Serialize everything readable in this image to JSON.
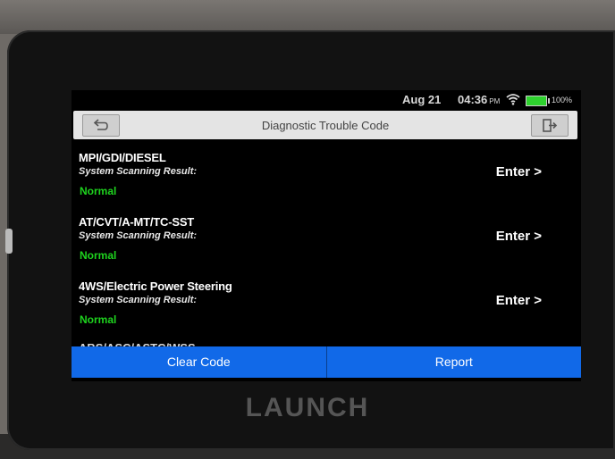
{
  "status_bar": {
    "date": "Aug 21",
    "time": "04:36",
    "ampm": "PM",
    "battery": "100%",
    "wifi_icon": "wifi-icon",
    "battery_icon": "battery-icon"
  },
  "header": {
    "title": "Diagnostic Trouble Code",
    "back_icon": "back-arrow-icon",
    "exit_icon": "exit-icon"
  },
  "systems": [
    {
      "name": "MPI/GDI/DIESEL",
      "sub": "System Scanning Result:",
      "status": "Normal",
      "enter": "Enter >"
    },
    {
      "name": "AT/CVT/A-MT/TC-SST",
      "sub": "System Scanning Result:",
      "status": "Normal",
      "enter": "Enter >"
    },
    {
      "name": "4WS/Electric Power Steering",
      "sub": "System Scanning Result:",
      "status": "Normal",
      "enter": "Enter >"
    }
  ],
  "next_item_partial": "ABS/ASC/ASTC/WSS",
  "actions": {
    "clear_code": "Clear Code",
    "report": "Report"
  },
  "device": {
    "brand": "LAUNCH"
  },
  "colors": {
    "accent_blue": "#1169e8",
    "status_green": "#1ed31e"
  }
}
